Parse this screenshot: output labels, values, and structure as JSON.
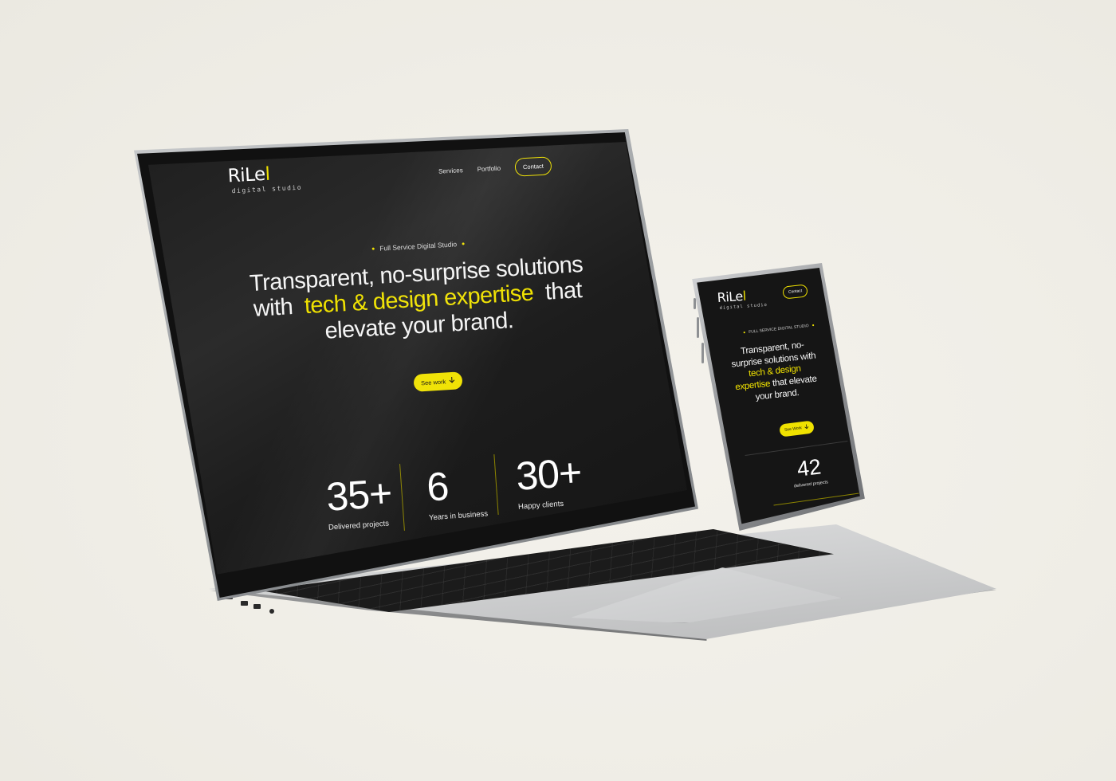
{
  "colors": {
    "background": "#f1efe8",
    "site_background": "#1b1b1b",
    "accent": "#f0e200",
    "text": "#f5f5f5"
  },
  "laptop": {
    "logo": {
      "name": "RiLel",
      "tagline": "digital studio"
    },
    "nav": {
      "services": "Services",
      "portfolio": "Portfolio",
      "contact": "Contact"
    },
    "eyebrow": "Full Service Digital Studio",
    "hero": {
      "line1": "Transparent, no-surprise solutions",
      "with": "with",
      "highlight": "tech & design expertise",
      "that": "that",
      "line3": "elevate your brand."
    },
    "cta": {
      "label": "See work",
      "icon": "arrow-down-icon"
    },
    "stats": [
      {
        "value": "35+",
        "label": "Delivered projects"
      },
      {
        "value": "6",
        "label": "Years in business"
      },
      {
        "value": "30+",
        "label": "Happy clients"
      }
    ]
  },
  "phone": {
    "logo": {
      "name": "RiLel",
      "tagline": "digital studio"
    },
    "contact": "Contact",
    "eyebrow": "FULL SERVICE DIGITAL STUDIO",
    "hero": {
      "before": "Transparent, no-surprise solutions with",
      "highlight": "tech & design expertise",
      "after": "that elevate your brand."
    },
    "cta": {
      "label": "See Work",
      "icon": "arrow-down-icon"
    },
    "stat": {
      "value": "42",
      "label": "delivered projects"
    }
  }
}
